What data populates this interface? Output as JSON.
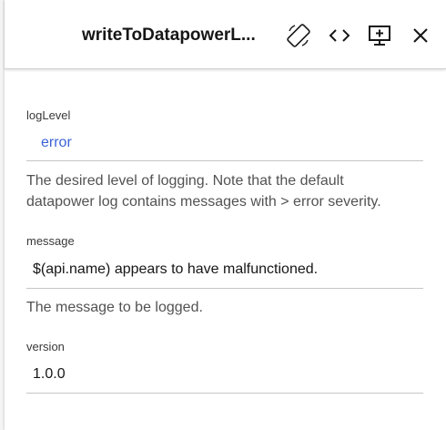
{
  "header": {
    "title": "writeToDatapowerL...",
    "icons": [
      "rotate-icon",
      "code-icon",
      "preview-icon",
      "close-icon"
    ]
  },
  "fields": [
    {
      "label": "logLevel",
      "value": "error",
      "description_line1": "The desired level of logging. Note that the default",
      "description_line2": "datapower log contains messages with > error severity."
    },
    {
      "label": "message",
      "value": "$(api.name) appears to have malfunctioned.",
      "description_line1": "The message to be logged."
    },
    {
      "label": "version",
      "value": "1.0.0"
    }
  ],
  "colors": {
    "link": "#3b63d6",
    "text": "#161616",
    "muted": "#525252",
    "divider": "#c6c6c6"
  }
}
